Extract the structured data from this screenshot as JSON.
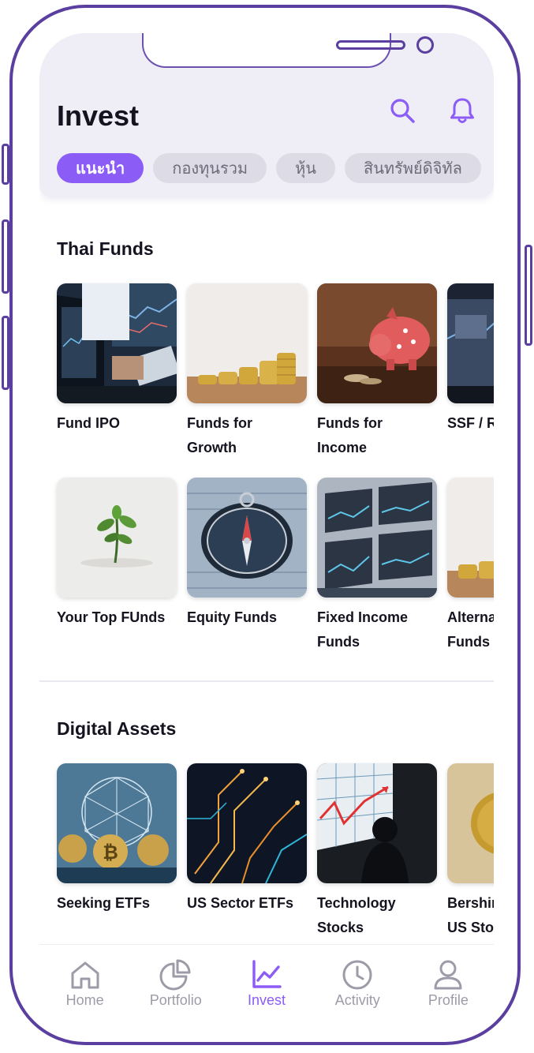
{
  "header": {
    "title": "Invest",
    "search_icon": "search-icon",
    "bell_icon": "bell-icon"
  },
  "chips": [
    {
      "label": "แนะนำ",
      "active": true
    },
    {
      "label": "กองทุนรวม",
      "active": false
    },
    {
      "label": "หุ้น",
      "active": false
    },
    {
      "label": "สินทรัพย์ดิจิทัล",
      "active": false
    }
  ],
  "thai_funds": {
    "title": "Thai Funds",
    "row1": [
      {
        "label": "Fund IPO"
      },
      {
        "label": "Funds for\nGrowth"
      },
      {
        "label": "Funds for\nIncome"
      },
      {
        "label": "SSF / R"
      }
    ],
    "row2": [
      {
        "label": "Your Top FUnds"
      },
      {
        "label": "Equity Funds"
      },
      {
        "label": "Fixed Income\nFunds"
      },
      {
        "label": "Alterna\nFunds"
      }
    ]
  },
  "digital_assets": {
    "title": "Digital Assets",
    "row": [
      {
        "label": "Seeking ETFs"
      },
      {
        "label": "US Sector ETFs"
      },
      {
        "label": "Technology\nStocks"
      },
      {
        "label": "Bershin\nUS Stoc"
      }
    ]
  },
  "tabbar": [
    {
      "label": "Home",
      "icon": "home-icon",
      "active": false
    },
    {
      "label": "Portfolio",
      "icon": "pie-chart-icon",
      "active": false
    },
    {
      "label": "Invest",
      "icon": "line-chart-icon",
      "active": true
    },
    {
      "label": "Activity",
      "icon": "clock-icon",
      "active": false
    },
    {
      "label": "Profile",
      "icon": "user-icon",
      "active": false
    }
  ],
  "colors": {
    "accent": "#8b5cf6",
    "frame": "#5a3fa0",
    "header_bg": "#efedf6"
  }
}
